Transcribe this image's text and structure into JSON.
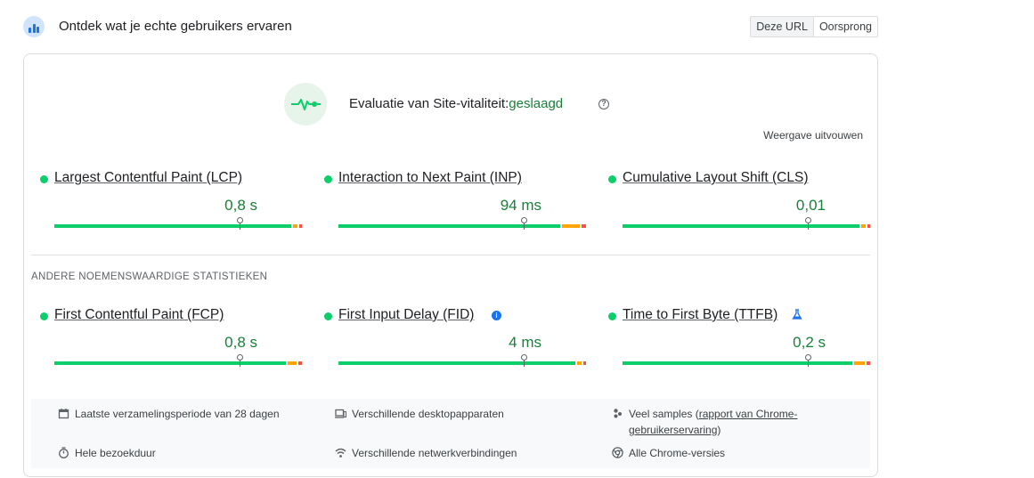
{
  "header": {
    "title": "Ontdek wat je echte gebruikers ervaren"
  },
  "toggle": {
    "url": "Deze URL",
    "origin": "Oorsprong"
  },
  "assessment": {
    "label": "Evaluatie van Site-vitaliteit:",
    "status": "geslaagd",
    "expand": "Weergave uitvouwen"
  },
  "core_metrics": [
    {
      "name": "Largest Contentful Paint (LCP)",
      "value": "0,8 s",
      "segments": [
        0.97,
        0.02,
        0.01
      ],
      "percentile": 0.75
    },
    {
      "name": "Interaction to Next Paint (INP)",
      "value": "94 ms",
      "segments": [
        0.91,
        0.07,
        0.02
      ],
      "percentile": 0.75
    },
    {
      "name": "Cumulative Layout Shift (CLS)",
      "value": "0,01",
      "segments": [
        0.97,
        0.02,
        0.01
      ],
      "percentile": 0.75
    }
  ],
  "other_title": "ANDERE NOEMENSWAARDIGE STATISTIEKEN",
  "other_metrics": [
    {
      "name": "First Contentful Paint (FCP)",
      "value": "0,8 s",
      "segments": [
        0.95,
        0.035,
        0.015
      ],
      "percentile": 0.75
    },
    {
      "name": "First Input Delay (FID)",
      "value": "4 ms",
      "segments": [
        0.97,
        0.02,
        0.01
      ],
      "percentile": 0.75
    },
    {
      "name": "Time to First Byte (TTFB)",
      "value": "0,2 s",
      "segments": [
        0.94,
        0.045,
        0.015
      ],
      "percentile": 0.75
    }
  ],
  "footer": {
    "period": "Laatste verzamelingsperiode van 28 dagen",
    "devices": "Verschillende desktopapparaten",
    "samples_prefix": "Veel samples (",
    "samples_link": "rapport van Chrome-gebruikerservaring",
    "samples_suffix": ")",
    "duration": "Hele bezoekduur",
    "network": "Verschillende netwerkverbindingen",
    "versions": "Alle Chrome-versies"
  },
  "colors": {
    "good": "#0cce6b",
    "ni": "#ffa400",
    "poor": "#ff4e42",
    "pass_text": "#188038"
  }
}
